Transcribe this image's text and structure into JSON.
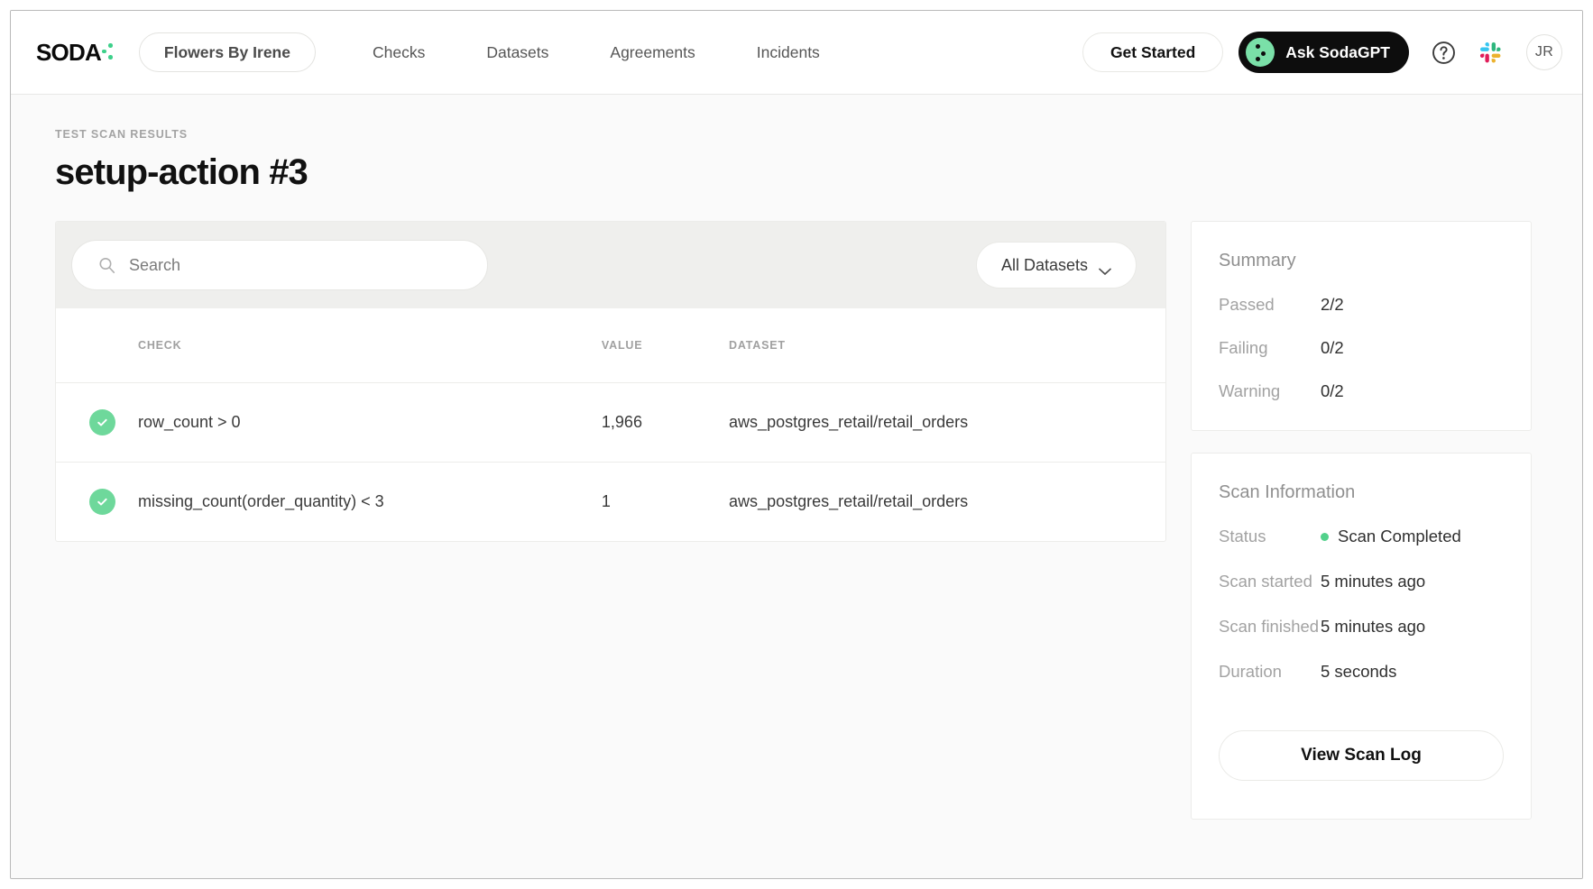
{
  "header": {
    "logo_text": "SODA",
    "logo_icon": "soda-dots-logo",
    "workspace": "Flowers By Irene",
    "nav": [
      {
        "label": "Checks"
      },
      {
        "label": "Datasets"
      },
      {
        "label": "Agreements"
      },
      {
        "label": "Incidents"
      }
    ],
    "get_started": "Get Started",
    "sodagpt": "Ask SodaGPT",
    "help_icon": "question-mark-circle-icon",
    "slack_icon": "slack-icon",
    "avatar_initials": "JR",
    "accent_green": "#7ae0a8",
    "sodagpt_bg": "#0d0d0d"
  },
  "page": {
    "eyebrow": "TEST SCAN RESULTS",
    "title": "setup-action #3"
  },
  "toolbar": {
    "search_placeholder": "Search",
    "search_value": "",
    "search_icon": "search-icon",
    "dataset_filter": "All Datasets",
    "chevron_icon": "chevron-down-icon"
  },
  "table": {
    "columns": [
      "CHECK",
      "VALUE",
      "DATASET"
    ],
    "rows": [
      {
        "status": "passed",
        "status_icon": "check-circle-icon",
        "check": "row_count > 0",
        "value": "1,966",
        "dataset": "aws_postgres_retail/retail_orders"
      },
      {
        "status": "passed",
        "status_icon": "check-circle-icon",
        "check": "missing_count(order_quantity) < 3",
        "value": "1",
        "dataset": "aws_postgres_retail/retail_orders"
      }
    ]
  },
  "summary": {
    "title": "Summary",
    "items": [
      {
        "label": "Passed",
        "value": "2/2"
      },
      {
        "label": "Failing",
        "value": "0/2"
      },
      {
        "label": "Warning",
        "value": "0/2"
      }
    ]
  },
  "scan_info": {
    "title": "Scan Information",
    "status_label": "Status",
    "status_value": "Scan Completed",
    "status_dot_color": "#52d18b",
    "items": [
      {
        "label": "Scan started",
        "value": "5 minutes ago"
      },
      {
        "label": "Scan finished",
        "value": "5 minutes ago"
      },
      {
        "label": "Duration",
        "value": "5 seconds"
      }
    ],
    "button": "View Scan Log"
  }
}
